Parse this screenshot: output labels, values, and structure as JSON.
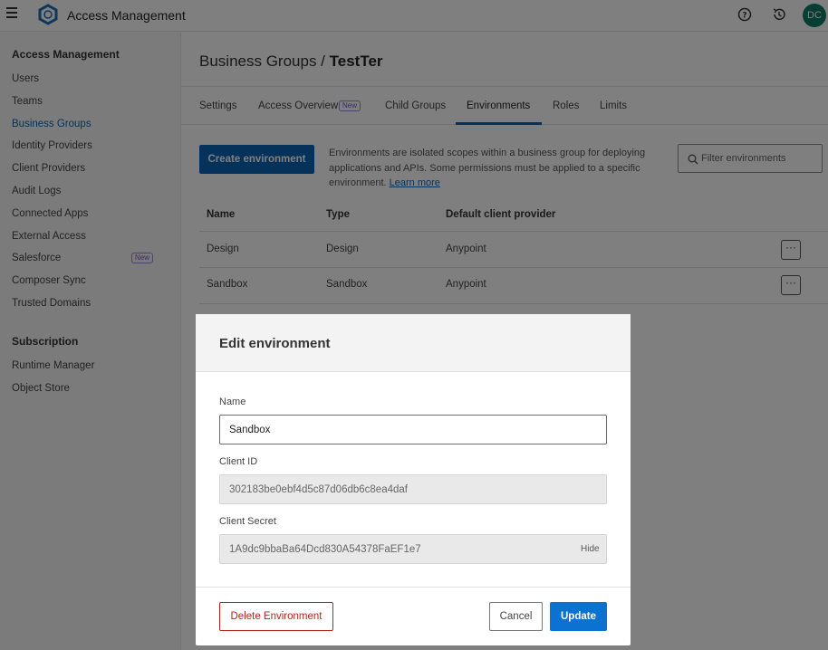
{
  "header": {
    "app_title": "Access Management",
    "avatar_initials": "DC",
    "icons": [
      "menu-icon",
      "logo-icon",
      "help-icon",
      "history-icon"
    ]
  },
  "sidebar": {
    "section1_title": "Access Management",
    "items": [
      {
        "label": "Users"
      },
      {
        "label": "Teams"
      },
      {
        "label": "Business Groups",
        "active": true
      },
      {
        "label": "Identity Providers"
      },
      {
        "label": "Client Providers"
      },
      {
        "label": "Audit Logs"
      },
      {
        "label": "Connected Apps"
      },
      {
        "label": "External Access"
      },
      {
        "label": "Salesforce",
        "badge": "New"
      },
      {
        "label": "Composer Sync"
      },
      {
        "label": "Trusted Domains"
      }
    ],
    "section2_title": "Subscription",
    "sub_items": [
      {
        "label": "Runtime Manager"
      },
      {
        "label": "Object Store"
      }
    ]
  },
  "breadcrumb": {
    "parent": "Business Groups /",
    "current": "TestTer"
  },
  "tabs": [
    {
      "label": "Settings"
    },
    {
      "label": "Access Overview",
      "badge": "New"
    },
    {
      "label": "Child Groups"
    },
    {
      "label": "Environments",
      "active": true
    },
    {
      "label": "Roles"
    },
    {
      "label": "Limits"
    }
  ],
  "toolbar": {
    "create_label": "Create environment",
    "description": "Environments are isolated scopes within a business group for deploying applications and APIs. Some permissions must be applied to a specific environment.",
    "learn_more": "Learn more",
    "filter_placeholder": "Filter environments"
  },
  "table": {
    "columns": [
      "Name",
      "Type",
      "Default client provider"
    ],
    "rows": [
      {
        "name": "Design",
        "type": "Design",
        "provider": "Anypoint",
        "more": "···"
      },
      {
        "name": "Sandbox",
        "type": "Sandbox",
        "provider": "Anypoint",
        "more": "···"
      }
    ]
  },
  "modal": {
    "title": "Edit environment",
    "name_label": "Name",
    "name_value": "Sandbox",
    "client_id_label": "Client ID",
    "client_id_value": "302183be0ebf4d5c87d06db6c8ea4daf",
    "client_secret_label": "Client Secret",
    "client_secret_value": "1A9dc9bbaBa64Dcd830A54378FaEF1e7",
    "hide_label": "Hide",
    "delete_label": "Delete Environment",
    "cancel_label": "Cancel",
    "update_label": "Update"
  },
  "colors": {
    "primary": "#0b64b6",
    "update_button": "#0b72d2",
    "danger": "#b3261e",
    "avatar_bg": "#0f7a66",
    "badge": "#6f54c4"
  }
}
